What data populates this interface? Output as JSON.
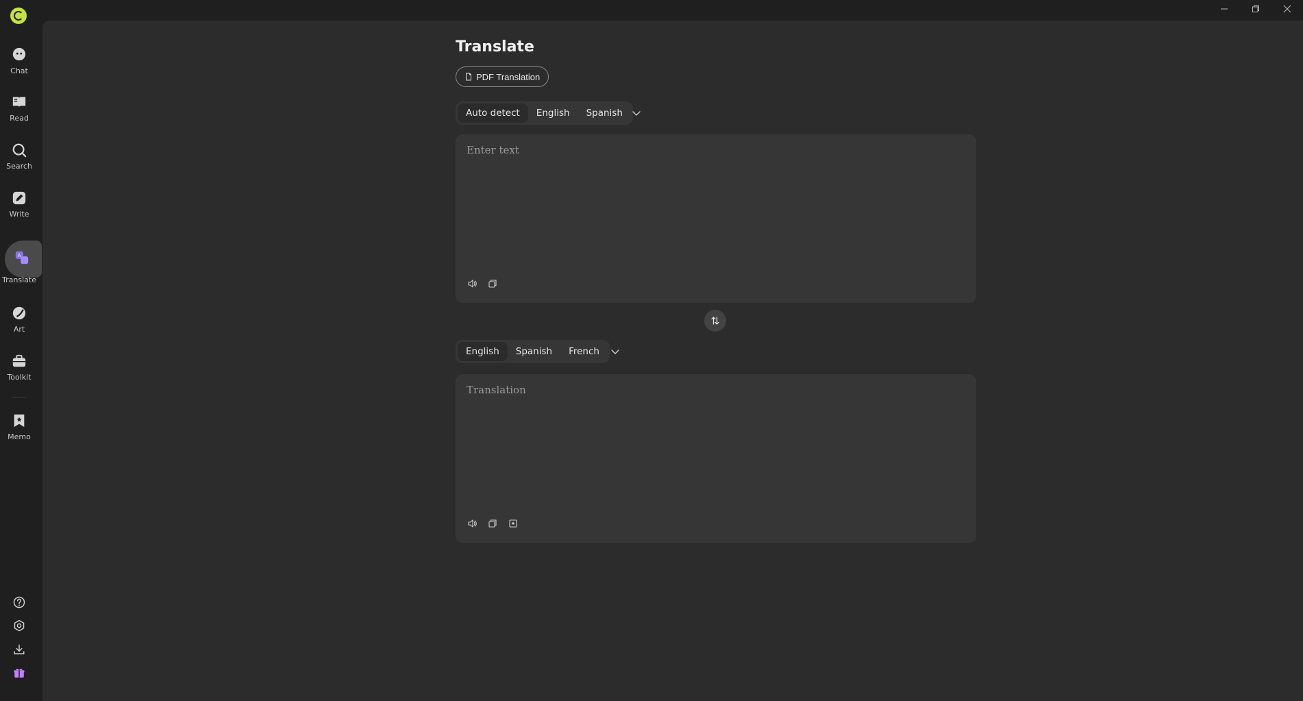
{
  "app": {
    "logo_icon": "app-logo-icon"
  },
  "sidebar": {
    "items": [
      {
        "id": "chat",
        "label": "Chat",
        "icon": "chat-bubble-icon"
      },
      {
        "id": "read",
        "label": "Read",
        "icon": "book-icon"
      },
      {
        "id": "search",
        "label": "Search",
        "icon": "search-icon"
      },
      {
        "id": "write",
        "label": "Write",
        "icon": "pencil-icon"
      },
      {
        "id": "translate",
        "label": "Translate",
        "icon": "translate-icon",
        "active": true
      },
      {
        "id": "art",
        "label": "Art",
        "icon": "palette-icon"
      },
      {
        "id": "toolkit",
        "label": "Toolkit",
        "icon": "briefcase-icon"
      },
      {
        "id": "memo",
        "label": "Memo",
        "icon": "bookmark-star-icon"
      }
    ],
    "bottom": [
      "help-icon",
      "settings-icon",
      "download-icon",
      "gift-icon"
    ]
  },
  "colors": {
    "accent": "#8b6cff",
    "logo": "#c6e33c",
    "gift": "#c77dff"
  },
  "main": {
    "title": "Translate",
    "pdf_button": "PDF Translation",
    "source": {
      "tabs": [
        "Auto detect",
        "English",
        "Spanish"
      ],
      "active_tab": 0,
      "placeholder": "Enter text",
      "value": ""
    },
    "target": {
      "tabs": [
        "English",
        "Spanish",
        "French"
      ],
      "active_tab": 0,
      "placeholder": "Translation",
      "value": ""
    }
  }
}
